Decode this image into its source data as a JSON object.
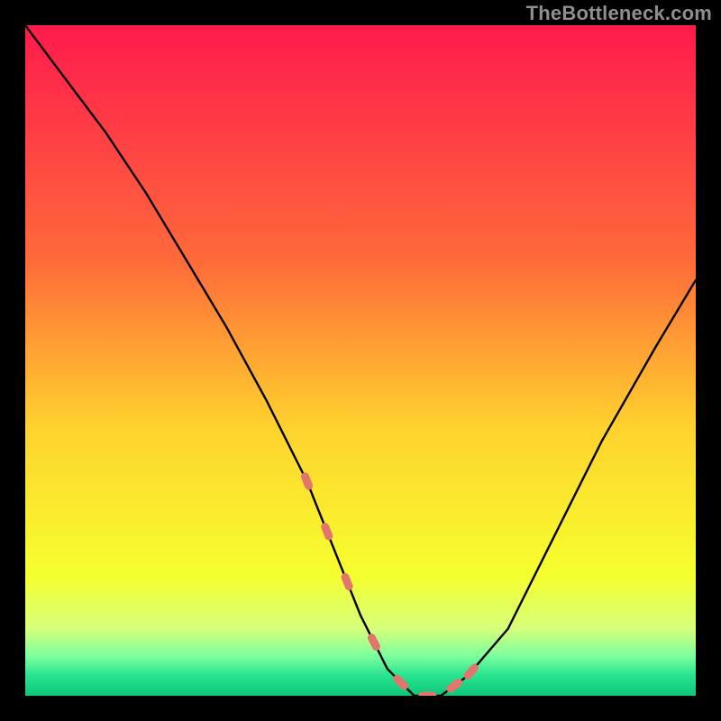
{
  "watermark": "TheBottleneck.com",
  "chart_data": {
    "type": "line",
    "title": "",
    "xlabel": "",
    "ylabel": "",
    "xlim": [
      0,
      100
    ],
    "ylim": [
      0,
      100
    ],
    "gradient_bands": [
      {
        "stop": 0.0,
        "color": "#ff1a4d"
      },
      {
        "stop": 0.35,
        "color": "#ff6a3a"
      },
      {
        "stop": 0.6,
        "color": "#ffd22e"
      },
      {
        "stop": 0.82,
        "color": "#f6ff2e"
      },
      {
        "stop": 0.9,
        "color": "#d6ff7a"
      },
      {
        "stop": 0.94,
        "color": "#7fff9e"
      },
      {
        "stop": 0.97,
        "color": "#28e38f"
      },
      {
        "stop": 1.0,
        "color": "#0dc77a"
      }
    ],
    "series": [
      {
        "name": "bottleneck-curve",
        "x": [
          0,
          6,
          12,
          18,
          24,
          30,
          36,
          42,
          46,
          50,
          54,
          58,
          62,
          66,
          72,
          78,
          86,
          94,
          100
        ],
        "y_mismatch": [
          100,
          92,
          84,
          75,
          65,
          55,
          44,
          32,
          22,
          12,
          4,
          0,
          0,
          3,
          10,
          22,
          38,
          52,
          62
        ]
      }
    ],
    "highlight_region": {
      "name": "recommended-range",
      "x_start": 42,
      "x_end": 68,
      "marker_color": "#e2766d"
    }
  }
}
